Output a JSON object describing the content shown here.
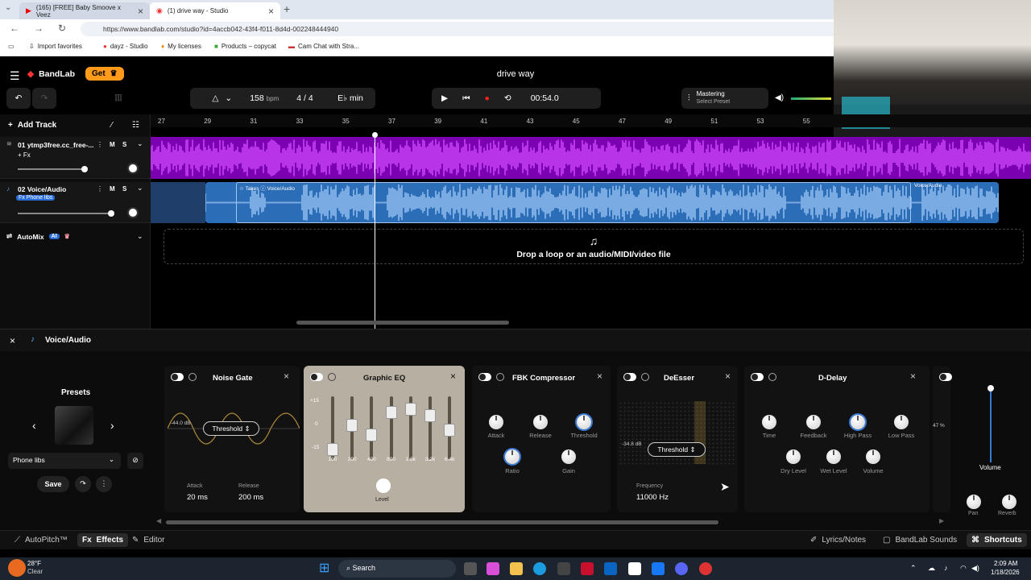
{
  "browser": {
    "tabs": [
      {
        "label": "(165) [FREE] Baby Smoove x Veez"
      },
      {
        "label": "(1) drive way - Studio"
      }
    ],
    "url": "https://www.bandlab.com/studio?id=4accb042-43f4-f011-8d4d-002248444940",
    "bookmarks": [
      "Import favorites",
      "dayz - Studio",
      "My licenses",
      "Products – copycat",
      "Cam Chat with Stra..."
    ]
  },
  "app": {
    "logo": "BandLab",
    "get_label": "Get",
    "project_title": "drive way",
    "tempo": "158",
    "tempo_unit": "bpm",
    "time_sig": "4 / 4",
    "key": "E♭ min",
    "time": "00:54.0",
    "mastering_title": "Mastering",
    "mastering_sub": "Select Preset",
    "add_track": "Add Track"
  },
  "ruler": [
    "27",
    "29",
    "31",
    "33",
    "35",
    "37",
    "39",
    "41",
    "43",
    "45",
    "47",
    "49",
    "51",
    "53",
    "55"
  ],
  "tracks": [
    {
      "name": "01  ytmp3free.cc_free-...",
      "fx": "+ Fx"
    },
    {
      "name": "02  Voice/Audio",
      "fx": "Fx Phone libs"
    }
  ],
  "clips": {
    "takes": "Takes",
    "voice1": "Voice/Audio",
    "voice2": "Voice/Audio"
  },
  "automix": {
    "label": "AutoMix",
    "badge": "AI"
  },
  "drop_text": "Drop a loop or an audio/MIDI/video file",
  "fx_panel": {
    "title": "Voice/Audio",
    "presets_label": "Presets",
    "preset_name": "Phone libs",
    "save": "Save",
    "noise_gate": {
      "title": "Noise Gate",
      "db": "-44.0 dB",
      "threshold": "Threshold",
      "attack_label": "Attack",
      "attack": "20 ms",
      "release_label": "Release",
      "release": "200 ms"
    },
    "eq": {
      "title": "Graphic EQ",
      "scale": [
        "+15",
        "0",
        "-15"
      ],
      "bands": [
        "100",
        "200",
        "400",
        "800",
        "1.6k",
        "3.2k",
        "6.4k"
      ],
      "level": "Level"
    },
    "compressor": {
      "title": "FBK Compressor",
      "knobs": [
        "Attack",
        "Release",
        "Threshold",
        "Ratio",
        "Gain"
      ]
    },
    "deesser": {
      "title": "DeEsser",
      "db": "-34.8 dB",
      "threshold": "Threshold",
      "freq_label": "Frequency",
      "freq": "11000 Hz"
    },
    "delay": {
      "title": "D-Delay",
      "knobs": [
        "Time",
        "Feedback",
        "High Pass",
        "Low Pass",
        "Dry Level",
        "Wet Level",
        "Volume"
      ]
    },
    "partial_pct": "47 %",
    "volume": "Volume",
    "pan": "Pan",
    "reverb": "Reverb"
  },
  "footer": {
    "autopitch": "AutoPitch™",
    "effects": "Effects",
    "editor": "Editor",
    "lyrics": "Lyrics/Notes",
    "sounds": "BandLab Sounds",
    "shortcuts": "Shortcuts"
  },
  "taskbar": {
    "temp": "28°F",
    "weather": "Clear",
    "search": "Search",
    "clock": "2:09 AM",
    "date": "1/18/2026"
  },
  "colors": {
    "track1": "#7a00b0",
    "track2": "#2c6db7",
    "accent": "#ff5a36"
  }
}
